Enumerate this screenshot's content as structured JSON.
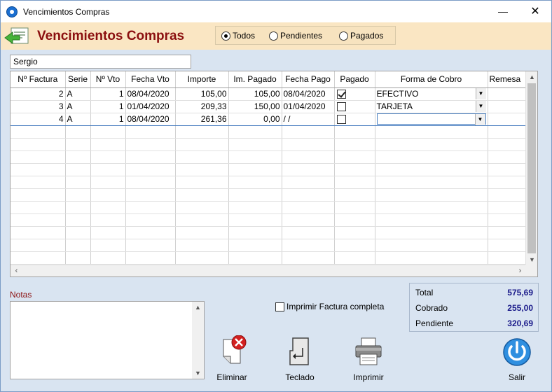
{
  "window": {
    "title": "Vencimientos Compras",
    "minimize": "—",
    "close": "✕"
  },
  "header": {
    "title": "Vencimientos Compras"
  },
  "filters": {
    "options": [
      "Todos",
      "Pendientes",
      "Pagados"
    ],
    "selected": "Todos"
  },
  "supplier": {
    "value": "Sergio"
  },
  "table": {
    "columns": [
      "Nº Factura",
      "Serie",
      "Nº Vto",
      "Fecha Vto",
      "Importe",
      "Im. Pagado",
      "Fecha Pago",
      "Pagado",
      "Forma de Cobro",
      "Remesa"
    ],
    "rows": [
      {
        "factura": "2",
        "serie": "A",
        "vto": "1",
        "fecha_vto": "08/04/2020",
        "importe": "105,00",
        "pagado_importe": "105,00",
        "fecha_pago": "08/04/2020",
        "pagado": true,
        "forma": "EFECTIVO",
        "remesa": ""
      },
      {
        "factura": "3",
        "serie": "A",
        "vto": "1",
        "fecha_vto": "01/04/2020",
        "importe": "209,33",
        "pagado_importe": "150,00",
        "fecha_pago": "01/04/2020",
        "pagado": false,
        "forma": "TARJETA",
        "remesa": ""
      },
      {
        "factura": "4",
        "serie": "A",
        "vto": "1",
        "fecha_vto": "08/04/2020",
        "importe": "261,36",
        "pagado_importe": "0,00",
        "fecha_pago": " /  /",
        "pagado": false,
        "forma": "",
        "remesa": ""
      }
    ],
    "empty_rows": 11
  },
  "notes": {
    "label": "Notas",
    "value": ""
  },
  "print_full": {
    "label": "Imprimir Factura completa",
    "checked": false
  },
  "totals": {
    "total_label": "Total",
    "total_value": "575,69",
    "cobrado_label": "Cobrado",
    "cobrado_value": "255,00",
    "pendiente_label": "Pendiente",
    "pendiente_value": "320,69"
  },
  "actions": {
    "eliminar": "Eliminar",
    "teclado": "Teclado",
    "imprimir": "Imprimir",
    "salir": "Salir"
  },
  "colors": {
    "header_bg": "#fae6c3",
    "title_red": "#8b1010",
    "body_bg": "#d9e4f1",
    "total_blue": "#1a1a8a"
  }
}
